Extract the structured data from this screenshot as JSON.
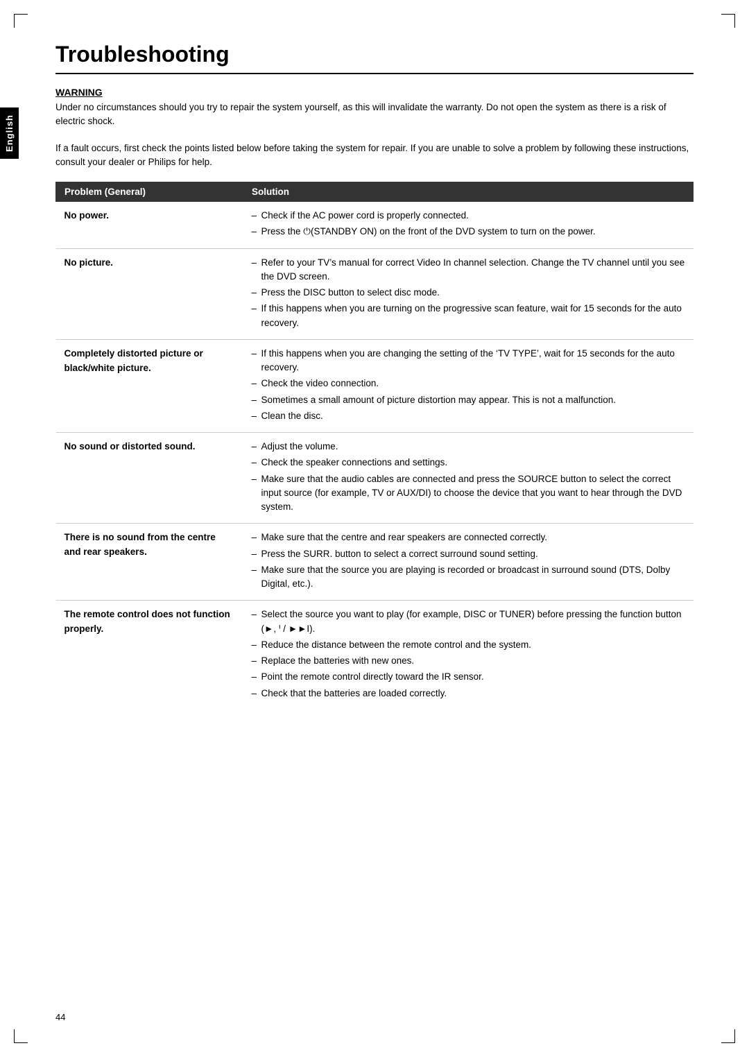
{
  "page": {
    "title": "Troubleshooting",
    "page_number": "44",
    "english_tab": "English",
    "warning": {
      "heading": "WARNING",
      "lines": [
        "Under no circumstances should you try to repair the system yourself, as this will invalidate the warranty. Do not open the system as there is a risk of electric shock."
      ]
    },
    "intro": "If a fault occurs, first check the points listed below before taking the system for repair. If you are unable to solve a problem by following these instructions, consult your dealer or Philips for help.",
    "table": {
      "col_problem": "Problem (General)",
      "col_solution": "Solution",
      "rows": [
        {
          "problem": "No power.",
          "solutions": [
            "Check if the AC power cord is properly connected.",
            "Press the ⏻(STANDBY ON) on the front of the DVD system to turn on the power."
          ]
        },
        {
          "problem": "No picture.",
          "solutions": [
            "Refer to your TV’s manual for correct Video In channel selection. Change the TV channel until you see the DVD screen.",
            "Press the DISC button to select disc mode.",
            "If this happens when you are turning on the progressive scan feature, wait for 15 seconds for the auto recovery."
          ]
        },
        {
          "problem": "Completely distorted picture or black/white picture.",
          "solutions": [
            "If this happens when you are changing the setting of the ‘TV TYPE’, wait for 15 seconds for the auto recovery.",
            "Check the video connection.",
            "Sometimes a small amount of picture distortion may appear. This is not a malfunction.",
            "Clean the disc."
          ]
        },
        {
          "problem": "No sound or distorted sound.",
          "solutions": [
            "Adjust the volume.",
            "Check the speaker connections and settings.",
            "Make sure that the audio cables are connected and press the SOURCE button to select the correct input source (for example, TV or AUX/DI) to choose the device that you want to hear through the DVD system."
          ]
        },
        {
          "problem": "There is no sound from the centre and rear speakers.",
          "solutions": [
            "Make sure that the centre and rear speakers are connected correctly.",
            "Press the SURR. button to select a correct surround sound setting.",
            "Make sure that the source you are playing is recorded or broadcast in surround sound (DTS, Dolby Digital, etc.)."
          ]
        },
        {
          "problem": "The remote control does not function properly.",
          "solutions": [
            "Select the source you want to play (for example, DISC or TUNER) before pressing the function button (►, ᑊ / ►►I).",
            "Reduce the distance between the remote control and the system.",
            "Replace the batteries with new ones.",
            "Point the remote control directly toward the IR sensor.",
            "Check that the batteries are loaded correctly."
          ]
        }
      ]
    }
  }
}
